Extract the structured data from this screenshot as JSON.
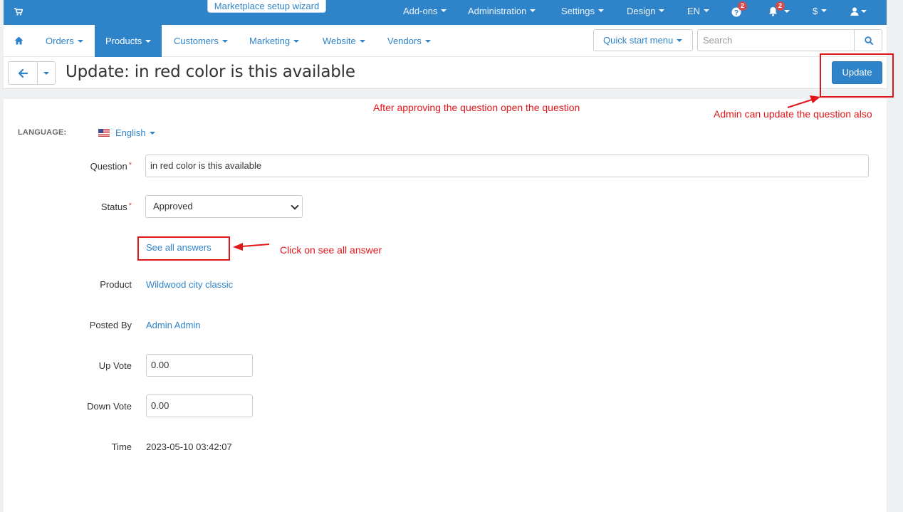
{
  "topbar": {
    "wizard_label": "Marketplace setup wizard",
    "menus": [
      "Add-ons",
      "Administration",
      "Settings",
      "Design",
      "EN"
    ],
    "help_badge": "2",
    "notif_badge": "2",
    "currency": "$"
  },
  "navbar": {
    "items": [
      "Orders",
      "Products",
      "Customers",
      "Marketing",
      "Website",
      "Vendors"
    ],
    "active": "Products",
    "quick_start": "Quick start menu",
    "search_placeholder": "Search"
  },
  "header": {
    "title": "Update: in red color is this available",
    "update_label": "Update"
  },
  "form": {
    "language_label": "LANGUAGE:",
    "language_value": "English",
    "question_label": "Question",
    "question_value": "in red color is this  available",
    "status_label": "Status",
    "status_value": "Approved",
    "see_answers": "See all answers",
    "product_label": "Product",
    "product_value": "Wildwood city classic",
    "posted_by_label": "Posted By",
    "posted_by_value": "Admin Admin",
    "up_vote_label": "Up Vote",
    "up_vote_value": "0.00",
    "down_vote_label": "Down Vote",
    "down_vote_value": "0.00",
    "time_label": "Time",
    "time_value": "2023-05-10 03:42:07"
  },
  "annotations": {
    "approve_note": "After approving the question open the question",
    "update_note": "Admin can update the question also",
    "answers_note": "Click on see all answer",
    "color": "#e0161b"
  }
}
